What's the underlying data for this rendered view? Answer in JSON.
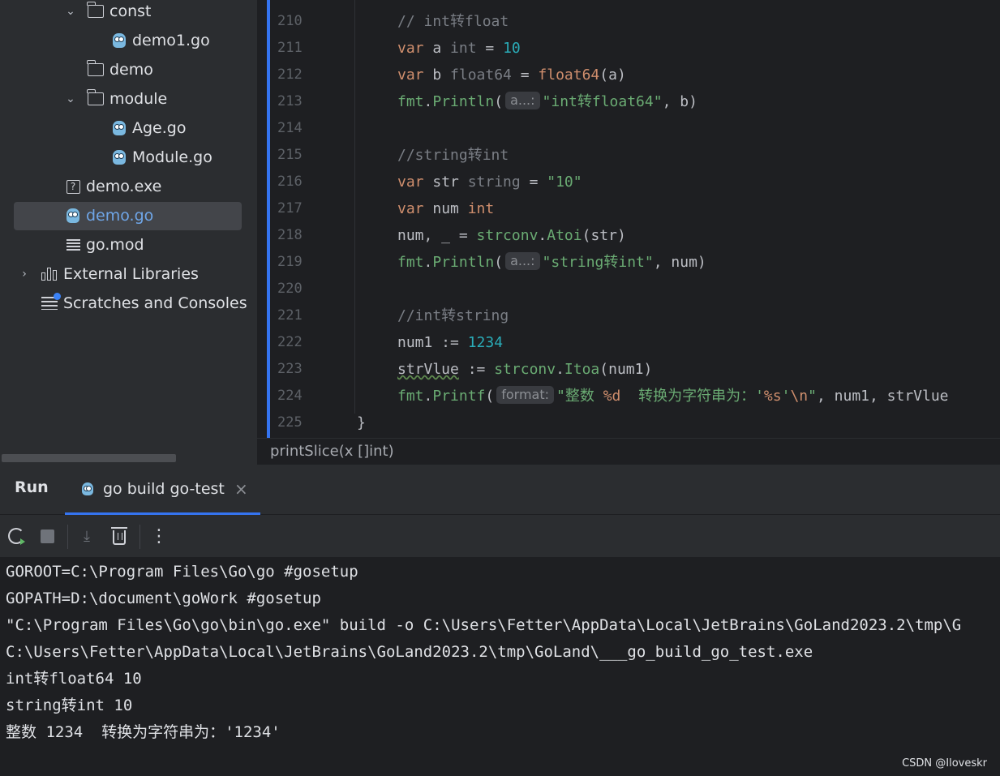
{
  "project_tree": [
    {
      "label": "const",
      "icon": "folder-icon",
      "chevron": "expanded",
      "depth": 1
    },
    {
      "label": "demo1.go",
      "icon": "go-file-icon",
      "depth": 2
    },
    {
      "label": "demo",
      "icon": "folder-icon",
      "chevron": "none",
      "depth": 1
    },
    {
      "label": "module",
      "icon": "folder-icon",
      "chevron": "expanded",
      "depth": 1
    },
    {
      "label": "Age.go",
      "icon": "go-file-icon",
      "depth": 2
    },
    {
      "label": "Module.go",
      "icon": "go-file-icon",
      "depth": 2
    },
    {
      "label": "demo.exe",
      "icon": "unknown-file-icon",
      "depth": 0
    },
    {
      "label": "demo.go",
      "icon": "go-file-icon",
      "depth": 0,
      "selected": true
    },
    {
      "label": "go.mod",
      "icon": "gomod-file-icon",
      "depth": 0
    },
    {
      "label": "External Libraries",
      "icon": "library-icon",
      "chevron": "collapsed",
      "depth": -1
    },
    {
      "label": "Scratches and Consoles",
      "icon": "scratches-icon",
      "depth": -1
    }
  ],
  "editor": {
    "line_numbers": [
      "210",
      "211",
      "212",
      "213",
      "214",
      "215",
      "216",
      "217",
      "218",
      "219",
      "220",
      "221",
      "222",
      "223",
      "224",
      "225"
    ],
    "code": {
      "l210": "// int转float",
      "l211_kw": "var",
      "l211_name": " a ",
      "l211_type": "int",
      "l211_eq": " = ",
      "l211_num": "10",
      "l212_kw": "var",
      "l212_name": " b ",
      "l212_type": "float64",
      "l212_eq": " = ",
      "l212_fn": "float64",
      "l212_args": "(a)",
      "l213_pkg": "fmt",
      "l213_dot": ".",
      "l213_fn": "Println",
      "l213_open": "(",
      "l213_hint": "a...:",
      "l213_str": "\"int转float64\"",
      "l213_rest": ", b)",
      "l215": "//string转int",
      "l216_kw": "var",
      "l216_name": " str ",
      "l216_type": "string",
      "l216_eq": " = ",
      "l216_str": "\"10\"",
      "l217_kw": "var",
      "l217_name": " num ",
      "l217_type": "int",
      "l218_lhs": "num, _ = ",
      "l218_pkg": "strconv",
      "l218_dot": ".",
      "l218_fn": "Atoi",
      "l218_args": "(str)",
      "l219_pkg": "fmt",
      "l219_dot": ".",
      "l219_fn": "Println",
      "l219_open": "(",
      "l219_hint": "a...:",
      "l219_str": "\"string转int\"",
      "l219_rest": ", num)",
      "l221": "//int转string",
      "l222_lhs": "num1 := ",
      "l222_num": "1234",
      "l223_var": "strVlue",
      "l223_op": " := ",
      "l223_pkg": "strconv",
      "l223_dot": ".",
      "l223_fn": "Itoa",
      "l223_args": "(num1)",
      "l224_pkg": "fmt",
      "l224_dot": ".",
      "l224_fn": "Printf",
      "l224_open": "(",
      "l224_hint": "format:",
      "l224_str1": "\"整数 ",
      "l224_fmt1": "%d",
      "l224_str2": "  转换为字符串为：'",
      "l224_fmt2": "%s",
      "l224_str3": "'",
      "l224_esc": "\\n",
      "l224_str4": "\"",
      "l224_rest": ", num1, strVlue",
      "l225": "}"
    }
  },
  "breadcrumb": "printSlice(x []int)",
  "run": {
    "title": "Run",
    "tab_label": "go build go-test",
    "tab_close": "×",
    "toolbar": {
      "rerun": "rerun-icon",
      "stop": "stop-icon",
      "scroll_end": "scroll-to-end-icon",
      "clear": "trash-icon",
      "more": "⋮"
    },
    "console": [
      "GOROOT=C:\\Program Files\\Go\\go #gosetup",
      "GOPATH=D:\\document\\goWork #gosetup",
      "\"C:\\Program Files\\Go\\go\\bin\\go.exe\" build -o C:\\Users\\Fetter\\AppData\\Local\\JetBrains\\GoLand2023.2\\tmp\\G",
      "C:\\Users\\Fetter\\AppData\\Local\\JetBrains\\GoLand2023.2\\tmp\\GoLand\\___go_build_go_test.exe",
      "int转float64 10",
      "string转int 10",
      "整数 1234  转换为字符串为：'1234'"
    ]
  },
  "watermark": "CSDN @Iloveskr",
  "colors": {
    "accent": "#3574f0",
    "keyword": "#cf8e6d",
    "string": "#6aab73",
    "number": "#2aacb8",
    "comment": "#7a7e85",
    "function": "#56a8f5"
  }
}
